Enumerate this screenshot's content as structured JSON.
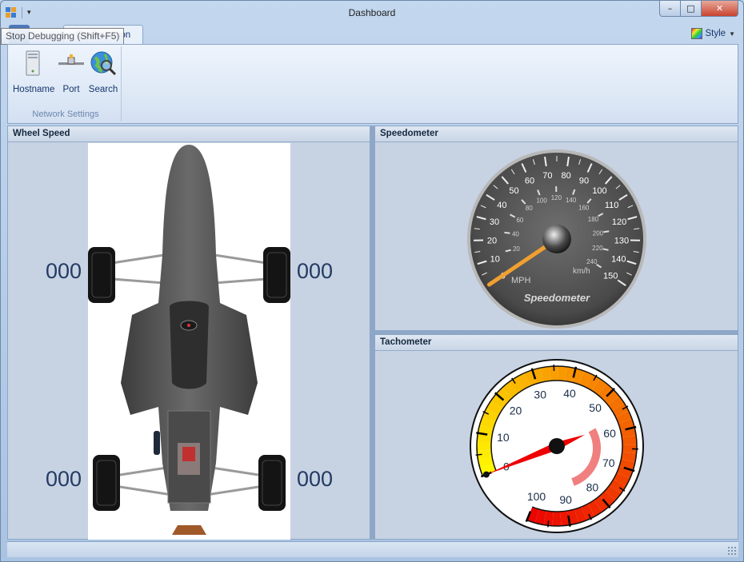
{
  "window": {
    "title": "Dashboard",
    "controls": {
      "minimize": "–",
      "maximize": "□",
      "close": "✕"
    }
  },
  "quick_access": {
    "dropdown_glyph": "▾"
  },
  "ribbon": {
    "tooltip": "Stop Debugging (Shift+F5)",
    "active_tab": "Configuration",
    "style_label": "Style",
    "groups": [
      {
        "label": "Network Settings",
        "buttons": [
          {
            "label": "Hostname",
            "icon": "server-icon"
          },
          {
            "label": "Port",
            "icon": "network-port-icon"
          },
          {
            "label": "Search",
            "icon": "globe-search-icon"
          }
        ]
      }
    ]
  },
  "panels": {
    "wheel_speed": {
      "title": "Wheel Speed",
      "front_left": "000",
      "front_right": "000",
      "rear_left": "000",
      "rear_right": "000"
    },
    "speedometer": {
      "title": "Speedometer",
      "gauge_label": "Speedometer",
      "mph_unit": "MPH",
      "kmh_unit": "km/h",
      "mph_ticks": [
        "0",
        "10",
        "20",
        "30",
        "40",
        "50",
        "60",
        "70",
        "80",
        "90",
        "100",
        "110",
        "120",
        "130",
        "140",
        "150"
      ],
      "kmh_ticks": [
        "0",
        "20",
        "40",
        "60",
        "80",
        "100",
        "120",
        "140",
        "160",
        "180",
        "200",
        "220",
        "240"
      ],
      "value_mph": 0
    },
    "tachometer": {
      "title": "Tachometer",
      "ticks": [
        "0",
        "10",
        "20",
        "30",
        "40",
        "50",
        "60",
        "70",
        "80",
        "90",
        "100"
      ],
      "value": 0
    }
  },
  "colors": {
    "panel_bg": "#c7d3e3",
    "wheel_number": "#243b63",
    "speedo_needle": "#f0a030",
    "tacho_needle": "#ee0000"
  }
}
